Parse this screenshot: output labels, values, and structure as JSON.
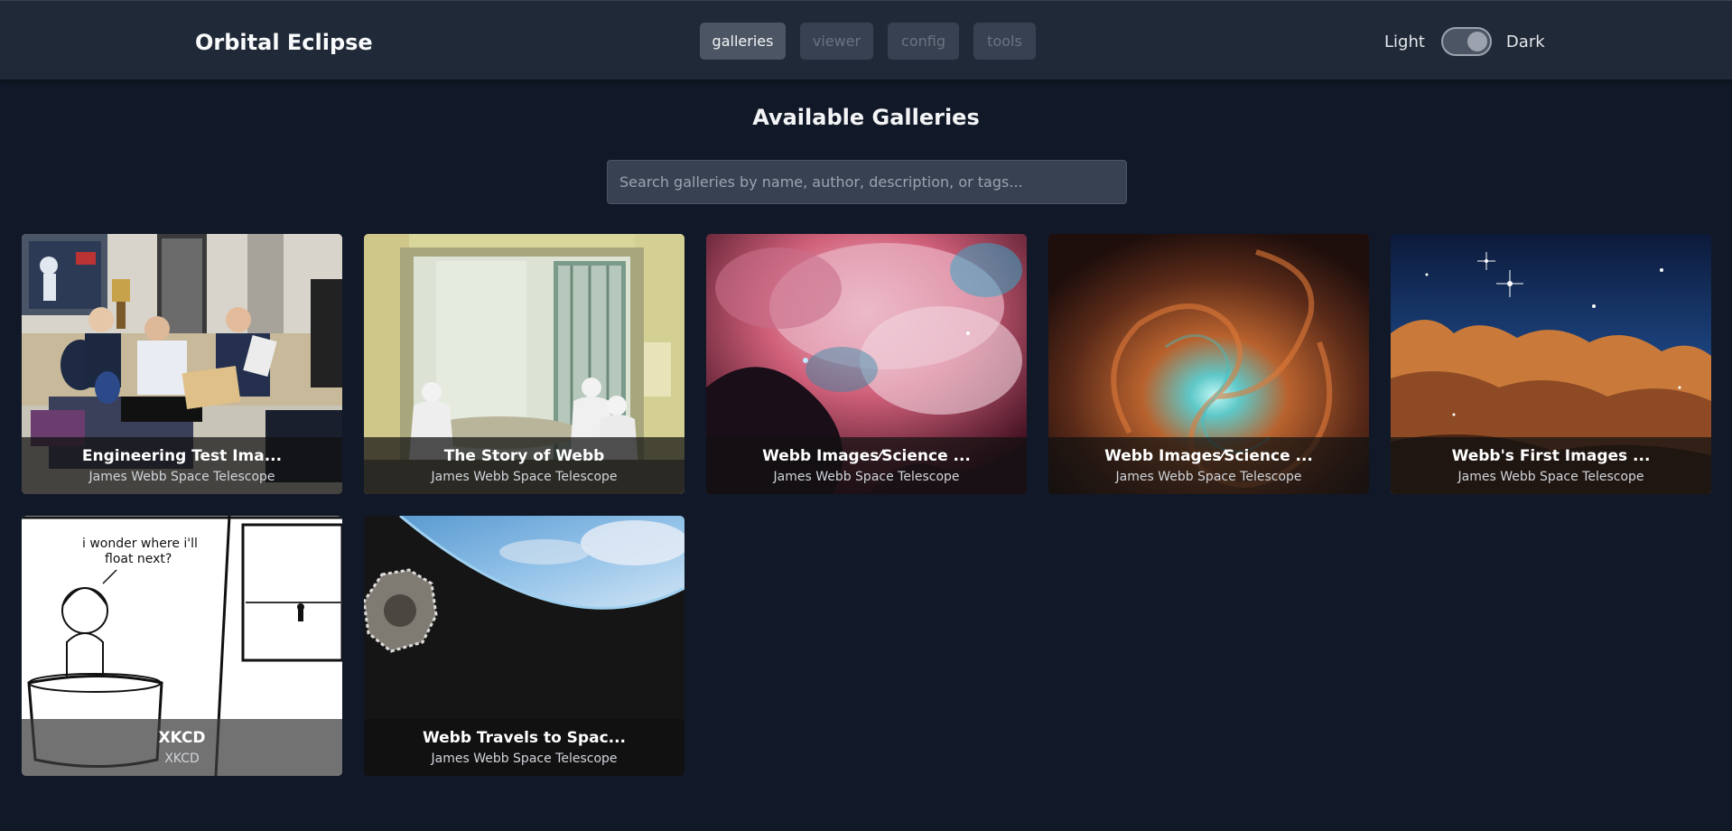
{
  "header": {
    "brand": "Orbital Eclipse",
    "nav": [
      {
        "label": "galleries",
        "active": true
      },
      {
        "label": "viewer",
        "active": false
      },
      {
        "label": "config",
        "active": false
      },
      {
        "label": "tools",
        "active": false
      }
    ],
    "theme": {
      "light_label": "Light",
      "dark_label": "Dark",
      "mode": "dark"
    }
  },
  "main": {
    "title": "Available Galleries",
    "search": {
      "placeholder": "Search galleries by name, author, description, or tags...",
      "value": ""
    },
    "galleries": [
      {
        "title": "Engineering Test Ima...",
        "author": "James Webb Space Telescope"
      },
      {
        "title": "The Story of Webb",
        "author": "James Webb Space Telescope"
      },
      {
        "title": "Webb Images⁄Science ...",
        "author": "James Webb Space Telescope"
      },
      {
        "title": "Webb Images⁄Science ...",
        "author": "James Webb Space Telescope"
      },
      {
        "title": "Webb's First Images ...",
        "author": "James Webb Space Telescope"
      },
      {
        "title": "XKCD",
        "author": "XKCD"
      },
      {
        "title": "Webb Travels to Spac...",
        "author": "James Webb Space Telescope"
      }
    ]
  },
  "colors": {
    "background": "#111827",
    "header": "#1f2937",
    "nav_active": "#4b5563",
    "nav_inactive": "#374151",
    "search_bg": "#374151"
  }
}
